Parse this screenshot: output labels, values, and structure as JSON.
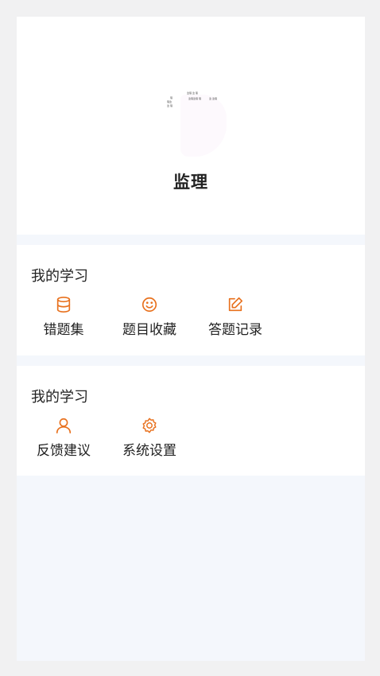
{
  "header": {
    "role_title": "监理",
    "avatar_tiny_texts": [
      "监理 监 理",
      "理 ",
      "理监",
      "监 理",
      "监理监理 理",
      "监 监理"
    ]
  },
  "section_study": {
    "title": "我的学习",
    "items": [
      {
        "label": "错题集",
        "icon": "database-icon"
      },
      {
        "label": "题目收藏",
        "icon": "smile-icon"
      },
      {
        "label": "答题记录",
        "icon": "edit-icon"
      }
    ]
  },
  "section_other": {
    "title": "我的学习",
    "items": [
      {
        "label": "反馈建议",
        "icon": "user-icon"
      },
      {
        "label": "系统设置",
        "icon": "settings-icon"
      }
    ]
  },
  "colors": {
    "accent": "#e8711e",
    "background": "#f4f7fc",
    "card": "#ffffff"
  }
}
